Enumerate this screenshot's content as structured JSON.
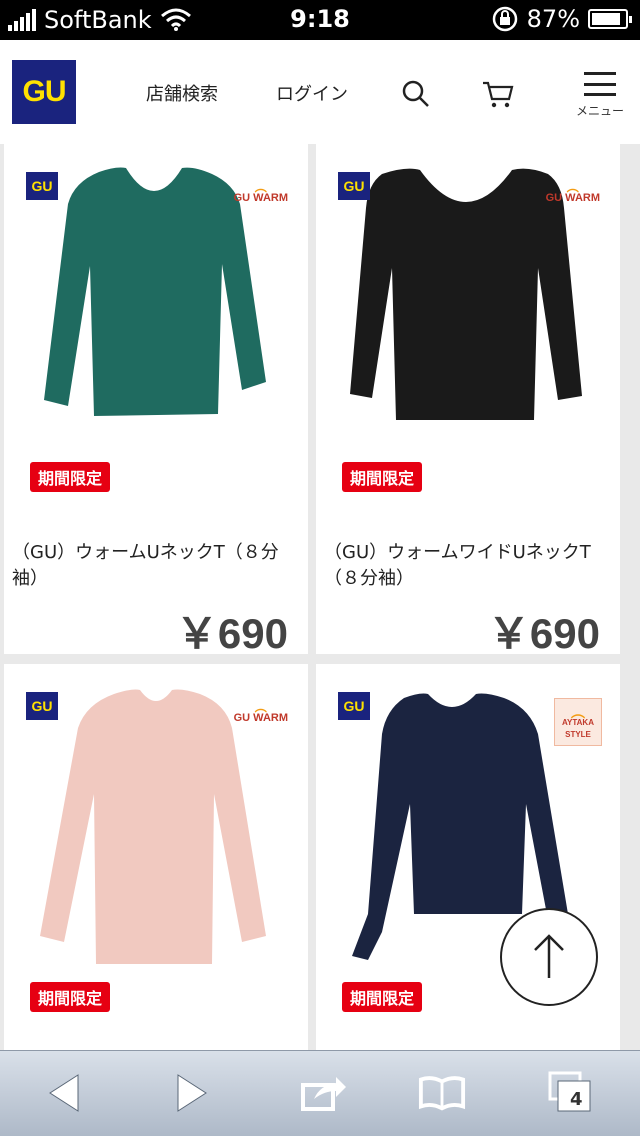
{
  "status_bar": {
    "carrier": "SoftBank",
    "time": "9:18",
    "battery": "87%",
    "battery_level": 0.87
  },
  "header": {
    "logo_text": "GU",
    "store_search": "店舗検索",
    "login": "ログイン",
    "menu_label": "メニュー"
  },
  "products": [
    {
      "badge": "期間限定",
      "name": "（GU）ウォームUネックT（８分袖）",
      "price": "￥690",
      "brand_badge": "GU",
      "tag": "GU WARM",
      "color": "#1f6b60"
    },
    {
      "badge": "期間限定",
      "name": "（GU）ウォームワイドUネックT（８分袖）",
      "price": "￥690",
      "brand_badge": "GU",
      "tag": "GU WARM",
      "color": "#1a1a1a"
    },
    {
      "badge": "期間限定",
      "brand_badge": "GU",
      "tag": "GU WARM",
      "color": "#f1c9c0"
    },
    {
      "badge": "期間限定",
      "brand_badge": "GU",
      "tag": "AYTAKA STYLE",
      "color": "#1b2440"
    }
  ],
  "toolbar": {
    "tabs_count": "4"
  }
}
